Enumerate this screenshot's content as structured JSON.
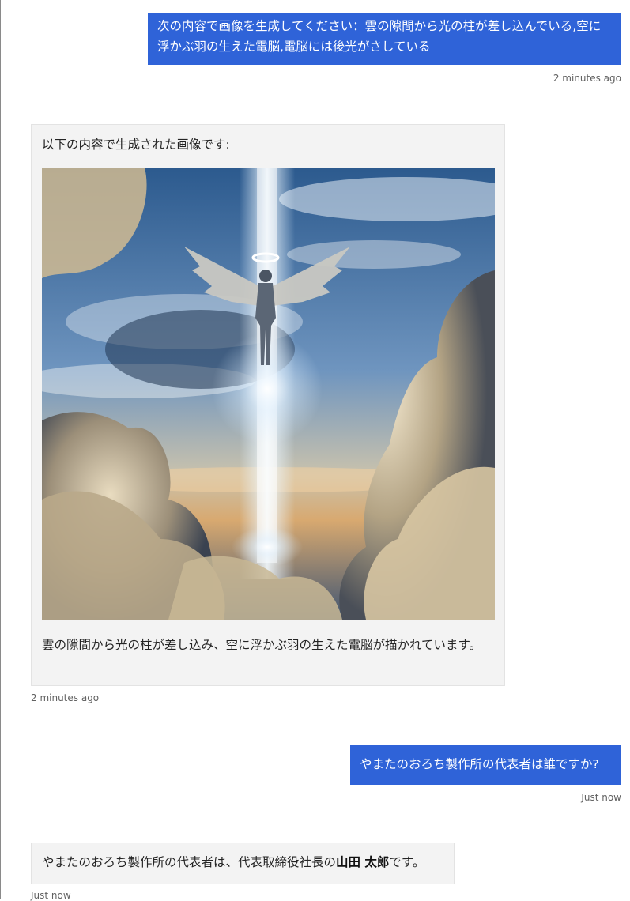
{
  "conversation": {
    "messages": [
      {
        "role": "user",
        "text": "次の内容で画像を生成してください：雲の隙間から光の柱が差し込んでいる,空に浮かぶ羽の生えた電脳,電脳には後光がさしている",
        "timestamp": "2 minutes ago"
      },
      {
        "role": "assistant",
        "intro": "以下の内容で生成された画像です:",
        "image_description": "雲の隙間から光の柱が差し込み、空に浮かぶ羽の生えた電脳が描かれています。",
        "timestamp": "2 minutes ago"
      },
      {
        "role": "user",
        "text": "やまたのおろち製作所の代表者は誰ですか?",
        "timestamp": "Just now"
      },
      {
        "role": "assistant",
        "text_before": "やまたのおろち製作所の代表者は、代表取締役社長の",
        "text_bold": "山田 太郎",
        "text_after": "です。",
        "timestamp": "Just now"
      }
    ]
  },
  "colors": {
    "user_bubble": "#2f63d8",
    "bot_bubble": "#f3f3f3",
    "timestamp": "#616161"
  }
}
